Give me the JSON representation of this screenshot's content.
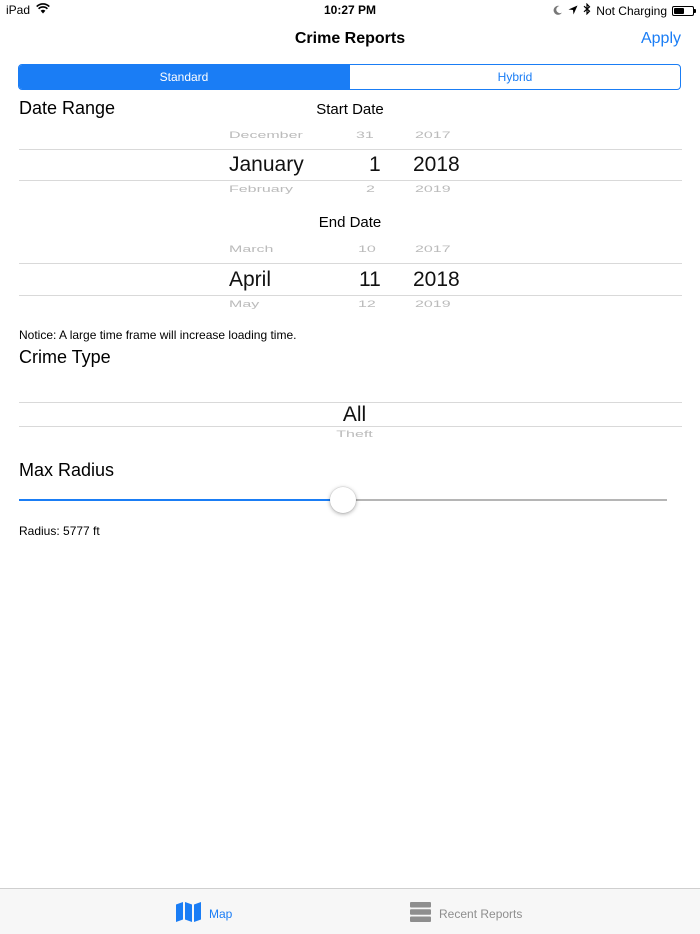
{
  "status_bar": {
    "device": "iPad",
    "time": "10:27 PM",
    "charging": "Not Charging",
    "battery_level": 0.55,
    "icons": [
      "wifi-icon",
      "moon-icon",
      "location-arrow-icon",
      "bluetooth-icon",
      "battery-icon"
    ]
  },
  "nav": {
    "title": "Crime Reports",
    "apply_label": "Apply"
  },
  "map_type": {
    "options": [
      "Standard",
      "Hybrid"
    ],
    "selected": "Standard"
  },
  "date_range": {
    "title": "Date Range",
    "start": {
      "label": "Start Date",
      "month": {
        "prev": "December",
        "selected": "January",
        "next": "February"
      },
      "day": {
        "prev": "31",
        "selected": "1",
        "next": "2"
      },
      "year": {
        "prev": "2017",
        "selected": "2018",
        "next": "2019"
      }
    },
    "end": {
      "label": "End Date",
      "month": {
        "prev": "March",
        "selected": "April",
        "next": "May"
      },
      "day": {
        "prev": "10",
        "selected": "11",
        "next": "12"
      },
      "year": {
        "prev": "2017",
        "selected": "2018",
        "next": "2019"
      }
    },
    "notice": "Notice: A large time frame will increase loading time."
  },
  "crime_type": {
    "title": "Crime Type",
    "selected": "All",
    "next": "Theft"
  },
  "max_radius": {
    "title": "Max Radius",
    "slider_value": 0.5,
    "label": "Radius: 5777 ft"
  },
  "accent_color": "#1a7df5",
  "tabs": [
    {
      "label": "Map",
      "icon": "map-icon",
      "active": true
    },
    {
      "label": "Recent Reports",
      "icon": "list-icon",
      "active": false
    }
  ]
}
